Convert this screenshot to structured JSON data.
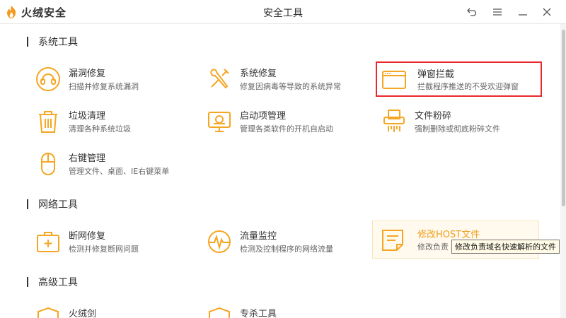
{
  "window": {
    "title": "安全工具",
    "brand": "火绒安全"
  },
  "sections": [
    {
      "title": "系统工具"
    },
    {
      "title": "网络工具"
    },
    {
      "title": "高级工具"
    }
  ],
  "tools": {
    "leak_fix": {
      "name": "漏洞修复",
      "desc": "扫描并修复系统漏洞",
      "icon": "shield-repair-icon"
    },
    "sys_fix": {
      "name": "系统修复",
      "desc": "修复因病毒等导致的系统异常",
      "icon": "wrench-screwdriver-icon"
    },
    "popup": {
      "name": "弹窗拦截",
      "desc": "拦截程序推送的不受欢迎弹窗",
      "icon": "popup-window-icon"
    },
    "junk": {
      "name": "垃圾清理",
      "desc": "清理各种系统垃圾",
      "icon": "trash-icon"
    },
    "startup": {
      "name": "启动项管理",
      "desc": "管理各类软件的开机自启动",
      "icon": "monitor-startup-icon"
    },
    "shred": {
      "name": "文件粉碎",
      "desc": "强制删除或彻底粉碎文件",
      "icon": "shredder-icon"
    },
    "rightclick": {
      "name": "右键管理",
      "desc": "管理文件、桌面、IE右键菜单",
      "icon": "mouse-icon"
    },
    "netfix": {
      "name": "断网修复",
      "desc": "检测并修复断网问题",
      "icon": "first-aid-kit-icon"
    },
    "traffic": {
      "name": "流量监控",
      "desc": "检测及控制程序的网络流量",
      "icon": "pulse-monitor-icon"
    },
    "hosts": {
      "name": "修改HOST文件",
      "desc": "修改负责",
      "icon": "host-file-icon"
    },
    "adv1": {
      "name": "火绒剑",
      "icon": "shield-icon"
    },
    "adv2": {
      "name": "专杀工具",
      "icon": "shield-icon"
    }
  },
  "tooltip": "修改负责域名快速解析的文件",
  "colors": {
    "accent": "#f5a623",
    "highlight": "#e8282c"
  }
}
